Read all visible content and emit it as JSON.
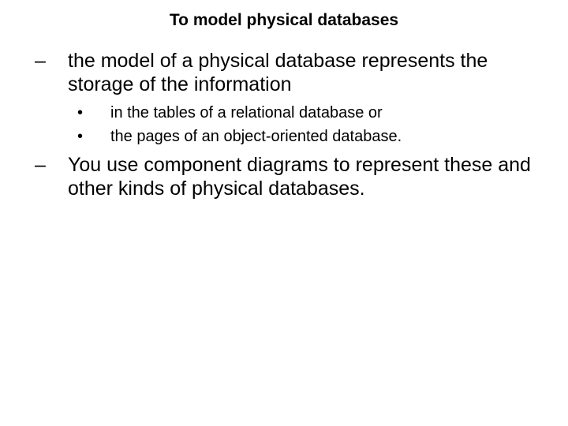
{
  "title": "To model physical databases",
  "items": [
    {
      "text": "the model of a physical database represents the storage of the information",
      "sub": [
        "in the tables of a relational database or",
        "the pages of an object-oriented database."
      ]
    },
    {
      "text": "You use component diagrams to represent these and other kinds of physical databases.",
      "sub": []
    }
  ],
  "markers": {
    "dash": "–",
    "bullet": "•"
  }
}
